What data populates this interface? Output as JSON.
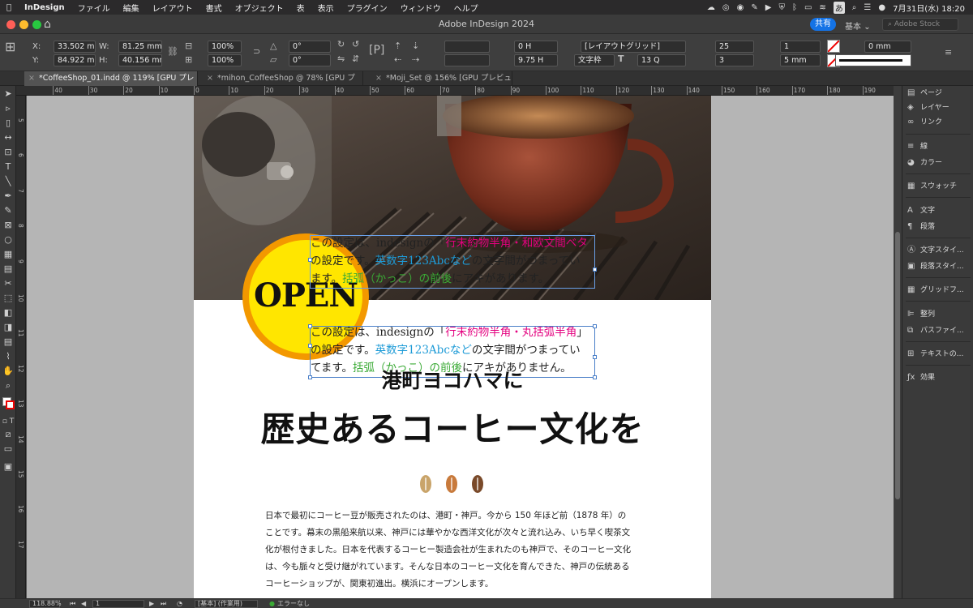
{
  "menubar": {
    "app": "InDesign",
    "items": [
      "ファイル",
      "編集",
      "レイアウト",
      "書式",
      "オブジェクト",
      "表",
      "表示",
      "プラグイン",
      "ウィンドウ",
      "ヘルプ"
    ],
    "input_mode": "あ",
    "datetime": "7月31日(水)  18:20"
  },
  "titlebar": {
    "title": "Adobe InDesign 2024",
    "share": "共有",
    "workspace": "基本",
    "stock_placeholder": "Adobe Stock"
  },
  "control": {
    "x_label": "X:",
    "y_label": "Y:",
    "w_label": "W:",
    "h_label": "H:",
    "x": "33.502 mm",
    "y": "84.922 mm",
    "w": "81.25 mm",
    "h": "40.156 mm",
    "scale_x": "100%",
    "scale_y": "100%",
    "rotate": "0°",
    "shear": "0°",
    "baseline": "0 H",
    "leading": "9.75 H",
    "grid_name": "[レイアウトグリッド]",
    "grid_frame": "文字枠",
    "font_size": "13 Q",
    "chars": "25",
    "lines": "3",
    "cols": "1",
    "gutter": "5 mm",
    "stroke": "0 mm"
  },
  "tabs": [
    {
      "label": "*CoffeeShop_01.indd @ 119% [GPU プレビュー]"
    },
    {
      "label": "*mihon_CoffeeShop @ 78% [GPU プレビュー]"
    },
    {
      "label": "*Moji_Set @ 156% [GPU プレビュー]"
    }
  ],
  "hruler": [
    "40",
    "30",
    "20",
    "10",
    "0",
    "10",
    "20",
    "30",
    "40",
    "50",
    "60",
    "70",
    "80",
    "90",
    "100",
    "110",
    "120",
    "130",
    "140",
    "150",
    "160",
    "170",
    "180",
    "190"
  ],
  "vruler": [
    "5",
    "6",
    "7",
    "8",
    "9",
    "10",
    "11",
    "12",
    "13",
    "14",
    "15",
    "16",
    "17"
  ],
  "canvas": {
    "open": "OPEN",
    "frame1": {
      "line1_a": "この設定は、indesignの「",
      "line1_b": "行末約物半角・和欧文間ベタ",
      "line2_a": "の設定です。",
      "line2_b": "英数字123Abcなど",
      "line2_c": "の文字間がつまってい",
      "line3_a": "ます。",
      "line3_b": "括弧（かっこ）の前後",
      "line3_c": "にアキがあります。"
    },
    "frame2": {
      "line1_a": "この設定は、indesignの「",
      "line1_b": "行末約物半角・丸括弧半角",
      "line1_c": "」",
      "line2_a": "の設定です。",
      "line2_b": "英数字123Abcなど",
      "line2_c": "の文字間がつまってい",
      "line3_a": "てます。",
      "line3_b": "括弧（かっこ）の前後",
      "line3_c": "にアキがありません。"
    },
    "sub_heading": "港町ヨコハマに",
    "main_heading": "歴史あるコーヒー文化を",
    "body": [
      "日本で最初にコーヒー豆が販売されたのは、港町・神戸。今から 150 年ほど前（1878 年）の",
      "ことです。幕末の黒船来航以来、神戸には華やかな西洋文化が次々と流れ込み、いち早く喫茶文",
      "化が根付きました。日本を代表するコーヒー製造会社が生まれたのも神戸で、そのコーヒー文化",
      "は、今も脈々と受け継がれています。そんな日本のコーヒー文化を育んできた、神戸の伝統ある",
      "コーヒーショップが、関東初進出。横浜にオープンします。"
    ],
    "bean_colors": [
      "#c9a46a",
      "#c87a3c",
      "#7a4a2a"
    ]
  },
  "panels": [
    {
      "icon": "page-icon",
      "label": "ページ"
    },
    {
      "icon": "layers-icon",
      "label": "レイヤー"
    },
    {
      "icon": "link-icon",
      "label": "リンク"
    },
    {
      "icon": "stroke-icon",
      "label": "線"
    },
    {
      "icon": "color-icon",
      "label": "カラー"
    },
    {
      "icon": "swatch-icon",
      "label": "スウォッチ"
    },
    {
      "icon": "char-icon",
      "label": "文字"
    },
    {
      "icon": "paragraph-icon",
      "label": "段落"
    },
    {
      "icon": "char-style-icon",
      "label": "文字スタイ..."
    },
    {
      "icon": "para-style-icon",
      "label": "段落スタイ..."
    },
    {
      "icon": "grid-icon",
      "label": "グリッドフ..."
    },
    {
      "icon": "align-icon",
      "label": "整列"
    },
    {
      "icon": "pathfinder-icon",
      "label": "パスファイ..."
    },
    {
      "icon": "text-wrap-icon",
      "label": "テキストの..."
    },
    {
      "icon": "effects-icon",
      "label": "効果"
    }
  ],
  "status": {
    "zoom": "118.88%",
    "page": "1",
    "style": "[基本] (作業用)",
    "errors": "エラーなし"
  },
  "colors": {
    "accent": "#1473e6",
    "badge_outer": "#f39800",
    "badge_inner": "#ffe600",
    "pink": "#e4007f",
    "blue": "#1e9bd7",
    "green": "#3aaa35"
  }
}
